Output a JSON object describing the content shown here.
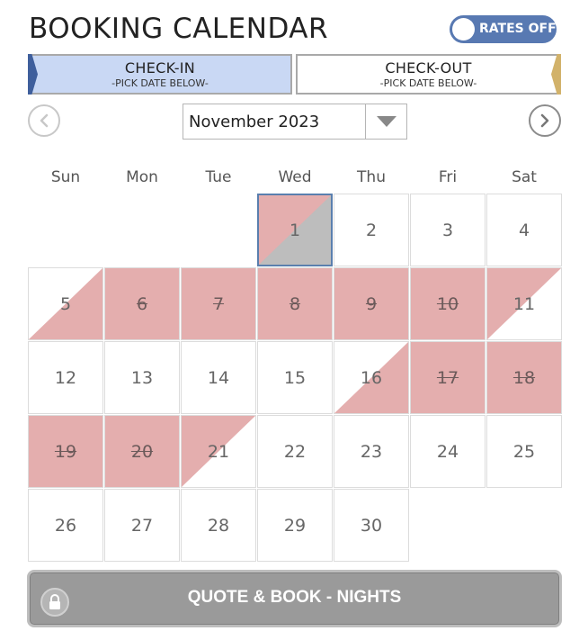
{
  "header": {
    "title": "BOOKING CALENDAR",
    "rates_toggle_label": "RATES OFF"
  },
  "selection": {
    "checkin_label": "CHECK-IN",
    "checkin_hint": "-PICK DATE BELOW-",
    "checkout_label": "CHECK-OUT",
    "checkout_hint": "-PICK DATE BELOW-"
  },
  "nav": {
    "month_value": "November 2023",
    "prev_icon": "chevron-left-icon",
    "next_icon": "chevron-right-icon",
    "dropdown_icon": "caret-down-icon"
  },
  "calendar": {
    "weekdays": [
      "Sun",
      "Mon",
      "Tue",
      "Wed",
      "Thu",
      "Fri",
      "Sat"
    ],
    "first_weekday_index": 3,
    "days": [
      {
        "day": "1",
        "state": "today-checkout"
      },
      {
        "day": "2",
        "state": "available"
      },
      {
        "day": "3",
        "state": "available"
      },
      {
        "day": "4",
        "state": "available"
      },
      {
        "day": "5",
        "state": "checkin"
      },
      {
        "day": "6",
        "state": "booked"
      },
      {
        "day": "7",
        "state": "booked"
      },
      {
        "day": "8",
        "state": "booked"
      },
      {
        "day": "9",
        "state": "booked"
      },
      {
        "day": "10",
        "state": "booked"
      },
      {
        "day": "11",
        "state": "checkout"
      },
      {
        "day": "12",
        "state": "available"
      },
      {
        "day": "13",
        "state": "available"
      },
      {
        "day": "14",
        "state": "available"
      },
      {
        "day": "15",
        "state": "available"
      },
      {
        "day": "16",
        "state": "checkin"
      },
      {
        "day": "17",
        "state": "booked"
      },
      {
        "day": "18",
        "state": "booked"
      },
      {
        "day": "19",
        "state": "booked"
      },
      {
        "day": "20",
        "state": "booked"
      },
      {
        "day": "21",
        "state": "checkout"
      },
      {
        "day": "22",
        "state": "available"
      },
      {
        "day": "23",
        "state": "available"
      },
      {
        "day": "24",
        "state": "available"
      },
      {
        "day": "25",
        "state": "available"
      },
      {
        "day": "26",
        "state": "available"
      },
      {
        "day": "27",
        "state": "available"
      },
      {
        "day": "28",
        "state": "available"
      },
      {
        "day": "29",
        "state": "available"
      },
      {
        "day": "30",
        "state": "available"
      }
    ]
  },
  "footer": {
    "book_button_label": "QUOTE & BOOK - NIGHTS",
    "lock_icon": "lock-icon"
  },
  "colors": {
    "accent_blue": "#5879b2",
    "checkin_tab_bg": "#c9d8f4",
    "checkout_marker": "#d2b26a",
    "booked": "#e4aeae",
    "today_grey": "#bdbdbd"
  }
}
